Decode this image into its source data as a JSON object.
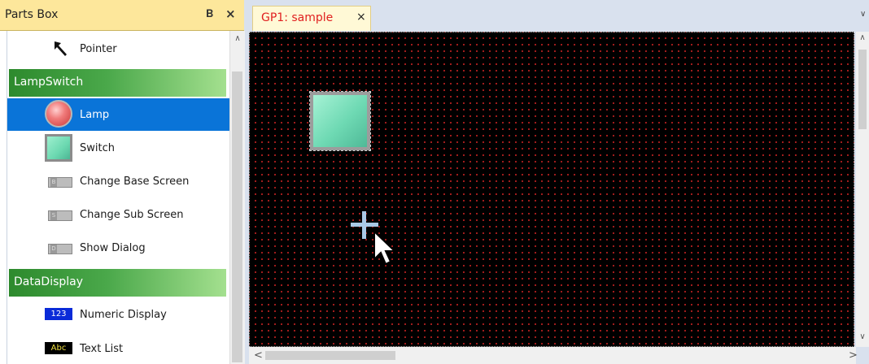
{
  "parts_box": {
    "title": "Parts Box",
    "pin_icon": "\u0004",
    "close_icon": "×",
    "pointer": {
      "label": "Pointer",
      "icon": "pointer-arrow-icon"
    },
    "categories": [
      {
        "label": "LampSwitch",
        "items": [
          {
            "label": "Lamp",
            "icon": "lamp-icon",
            "selected": true
          },
          {
            "label": "Switch",
            "icon": "switch-icon"
          },
          {
            "label": "Change Base Screen",
            "icon": "change-base-screen-icon",
            "badge": "B"
          },
          {
            "label": "Change Sub Screen",
            "icon": "change-sub-screen-icon",
            "badge": "S"
          },
          {
            "label": "Show Dialog",
            "icon": "show-dialog-icon",
            "badge": "D"
          }
        ]
      },
      {
        "label": "DataDisplay",
        "items": [
          {
            "label": "Numeric Display",
            "icon": "numeric-display-icon",
            "badge": "123"
          },
          {
            "label": "Text List",
            "icon": "text-list-icon",
            "badge": "Abc"
          }
        ]
      }
    ]
  },
  "document": {
    "tab_title": "GP1: sample",
    "tab_close": "×",
    "canvas_background": "#000000",
    "grid_dot_color": "#b82020"
  },
  "colors": {
    "panel_header": "#fde79b",
    "selection": "#0a74d8",
    "category_start": "#2d8a2d",
    "category_end": "#a4e08f"
  }
}
